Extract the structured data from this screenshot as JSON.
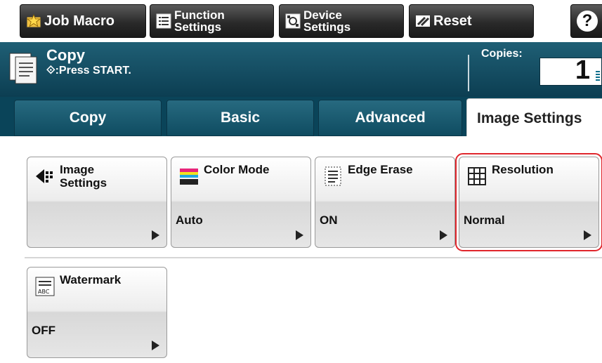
{
  "toolbar": {
    "job_macro": "Job Macro",
    "function_settings_line1": "Function",
    "function_settings_line2": "Settings",
    "device_settings_line1": "Device",
    "device_settings_line2": "Settings",
    "reset": "Reset",
    "help_icon_glyph": "?"
  },
  "status": {
    "title": "Copy",
    "message": "⟐:Press START.",
    "copies_label": "Copies:",
    "copies_value": "1"
  },
  "tabs": [
    {
      "label": "Copy",
      "active": false
    },
    {
      "label": "Basic",
      "active": false
    },
    {
      "label": "Advanced",
      "active": false
    },
    {
      "label": "Image Settings",
      "active": true
    }
  ],
  "settings": [
    {
      "title_line1": "Image",
      "title_line2": "Settings",
      "value": "",
      "icon": "image-settings-icon"
    },
    {
      "title_line1": "Color Mode",
      "title_line2": "",
      "value": "Auto",
      "icon": "color-mode-icon"
    },
    {
      "title_line1": "Edge Erase",
      "title_line2": "",
      "value": "ON",
      "icon": "edge-erase-icon"
    },
    {
      "title_line1": "Resolution",
      "title_line2": "",
      "value": "Normal",
      "icon": "resolution-icon",
      "selected": true
    },
    {
      "title_line1": "Watermark",
      "title_line2": "",
      "value": "OFF",
      "icon": "watermark-icon"
    }
  ],
  "colors": {
    "status_bar": "#0c3e52",
    "tab_bar": "#0a4459",
    "selection_outline": "#e0262c"
  }
}
